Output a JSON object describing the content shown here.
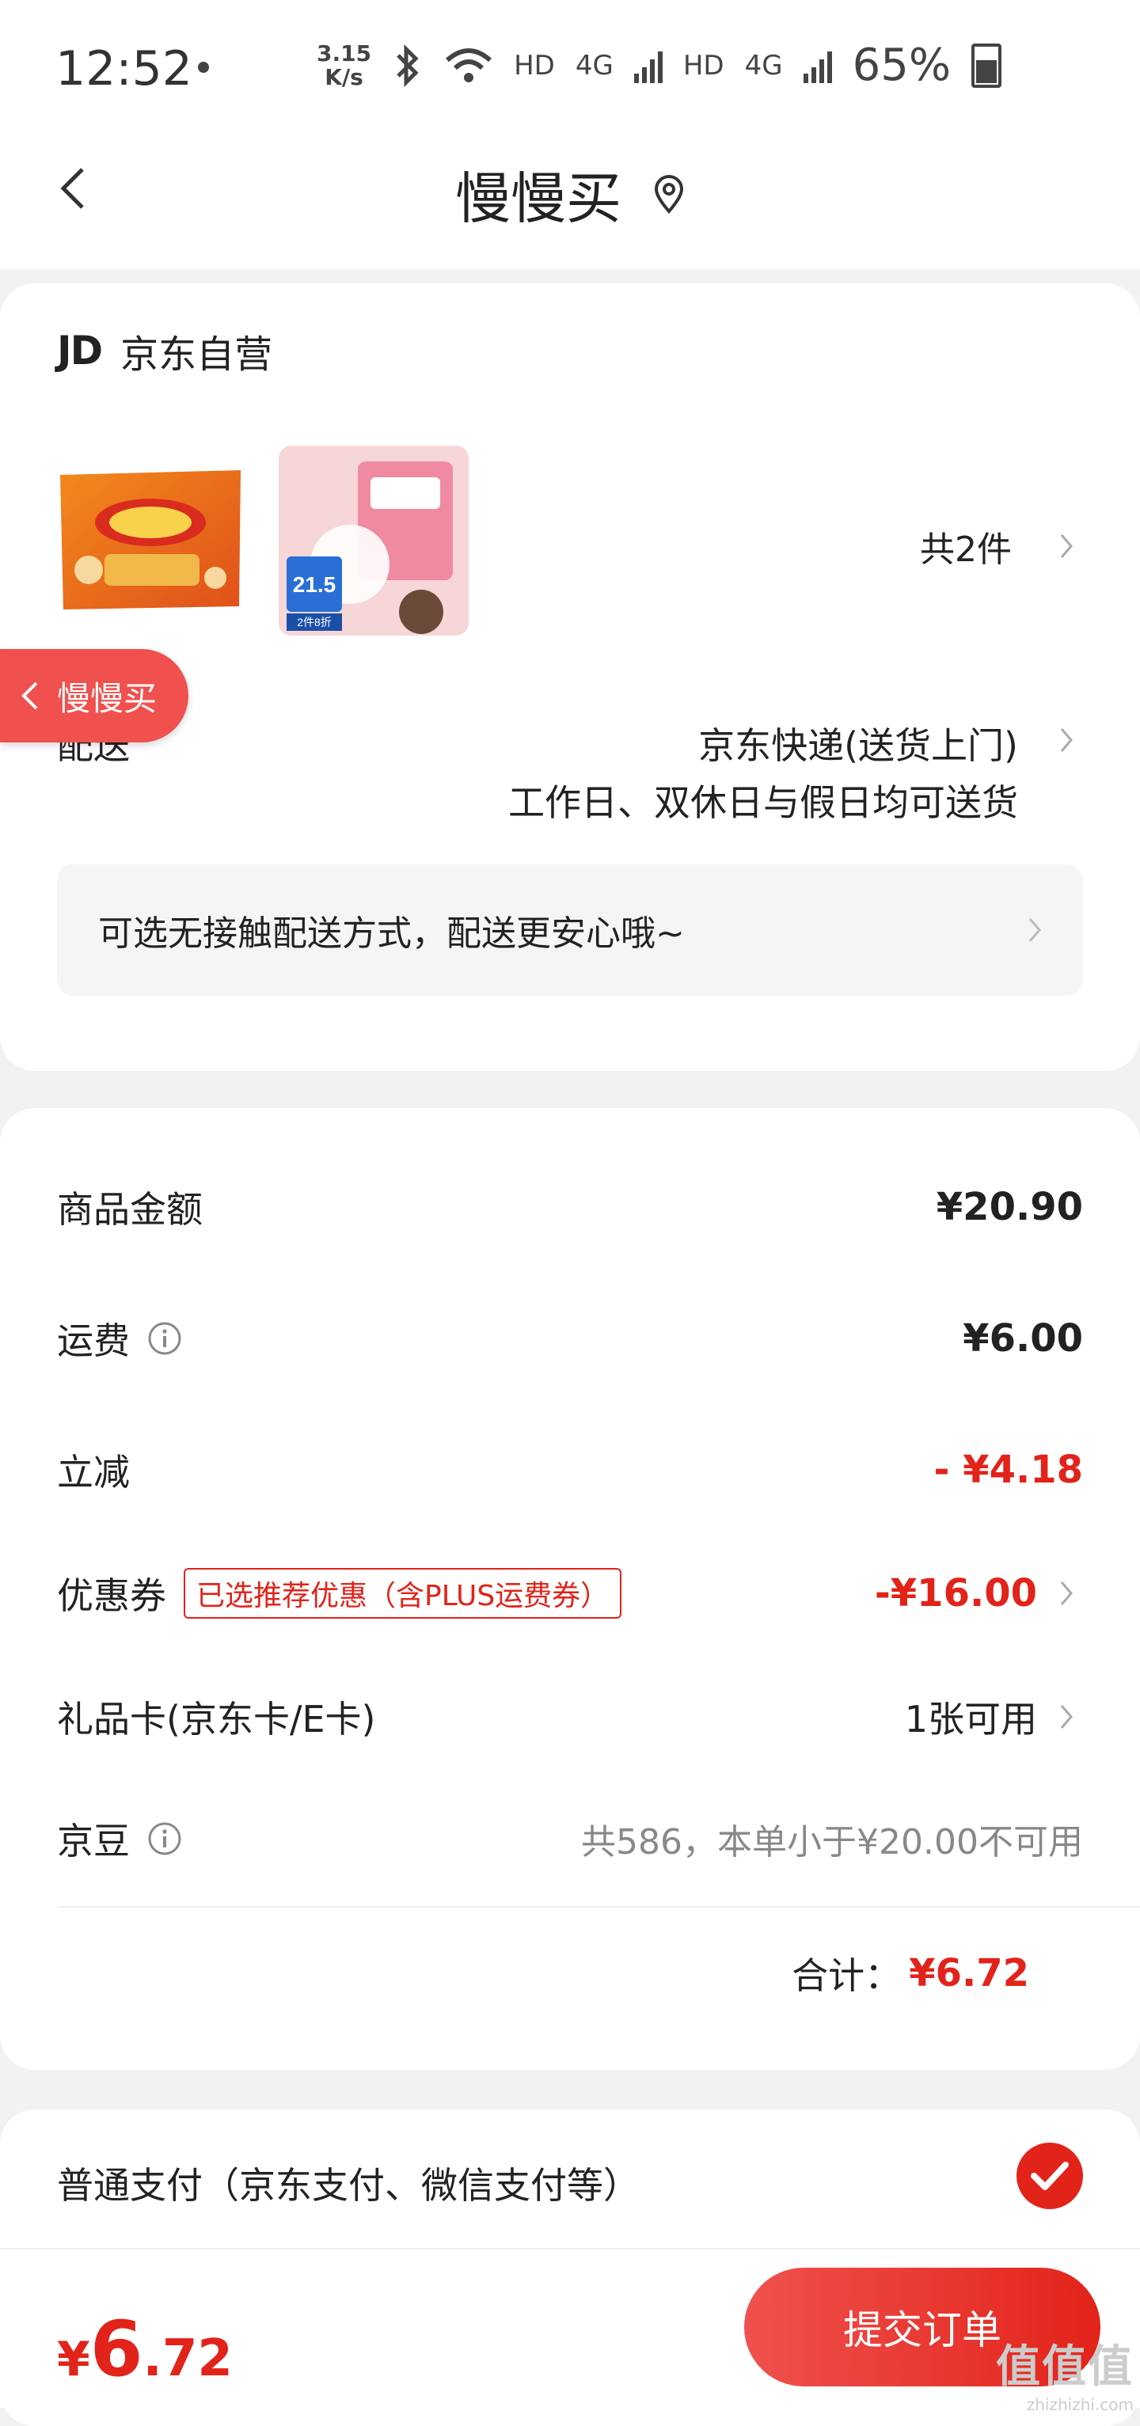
{
  "status_bar": {
    "time": "12:52",
    "speed": "3.15\nK/s",
    "hd1": "HD",
    "net1": "4G",
    "hd2": "HD",
    "net2": "4G",
    "battery": "65%"
  },
  "nav": {
    "title": "慢慢买"
  },
  "shop": {
    "logo": "JD",
    "name": "京东自营"
  },
  "items": {
    "count": "共2件",
    "product2_price_tag": "21.5",
    "product2_discount": "2件8折"
  },
  "float_tab": {
    "label": "慢慢买"
  },
  "delivery": {
    "label": "配送",
    "method": "京东快递(送货上门)",
    "time": "工作日、双休日与假日均可送货",
    "notice": "可选无接触配送方式，配送更安心哦~"
  },
  "summary": {
    "goods_label": "商品金额",
    "goods_amount": "¥20.90",
    "shipping_label": "运费",
    "shipping_amount": "¥6.00",
    "discount_label": "立减",
    "discount_amount": "- ¥4.18",
    "coupon_label": "优惠券",
    "coupon_tag": "已选推荐优惠（含PLUS运费券）",
    "coupon_amount": "-¥16.00",
    "giftcard_label": "礼品卡(京东卡/E卡)",
    "giftcard_value": "1张可用",
    "jingdou_label": "京豆",
    "jingdou_value": "共586，本单小于¥20.00不可用",
    "total_label": "合计：",
    "total_amount": "¥6.72"
  },
  "payment": {
    "label": "普通支付（京东支付、微信支付等）"
  },
  "bottom": {
    "currency": "¥",
    "price_int": "6",
    "price_dec": ".72",
    "submit": "提交订单"
  },
  "watermark": {
    "text": "值值值",
    "url": "zhizhizhi.com"
  },
  "colors": {
    "accent": "#e2231a",
    "tab": "#f0514e"
  }
}
